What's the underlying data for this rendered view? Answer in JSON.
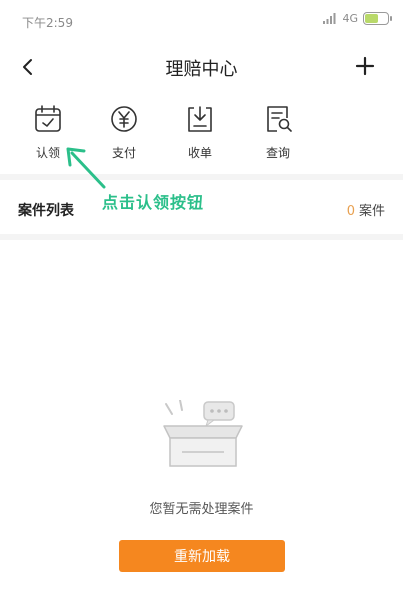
{
  "status_bar": {
    "time": "下午2:59",
    "network": "4G",
    "battery_level": 0.55,
    "battery_color": "#b9d96a"
  },
  "nav": {
    "title": "理赔中心",
    "back_icon": "chevron-left-icon",
    "add_icon": "plus-icon"
  },
  "quick_actions": [
    {
      "label": "认领",
      "icon": "calendar-check-icon"
    },
    {
      "label": "支付",
      "icon": "yen-circle-icon"
    },
    {
      "label": "收单",
      "icon": "download-tray-icon"
    },
    {
      "label": "查询",
      "icon": "document-search-icon"
    }
  ],
  "case_list": {
    "title": "案件列表",
    "count": "0",
    "unit": "案件"
  },
  "empty_state": {
    "message": "您暂无需处理案件",
    "icon": "empty-box-icon"
  },
  "reload_button": {
    "label": "重新加载"
  },
  "annotation": {
    "text": "点击认领按钮",
    "color": "#2bbf8a"
  },
  "colors": {
    "accent": "#f5871f",
    "count_accent": "#e8a050"
  }
}
